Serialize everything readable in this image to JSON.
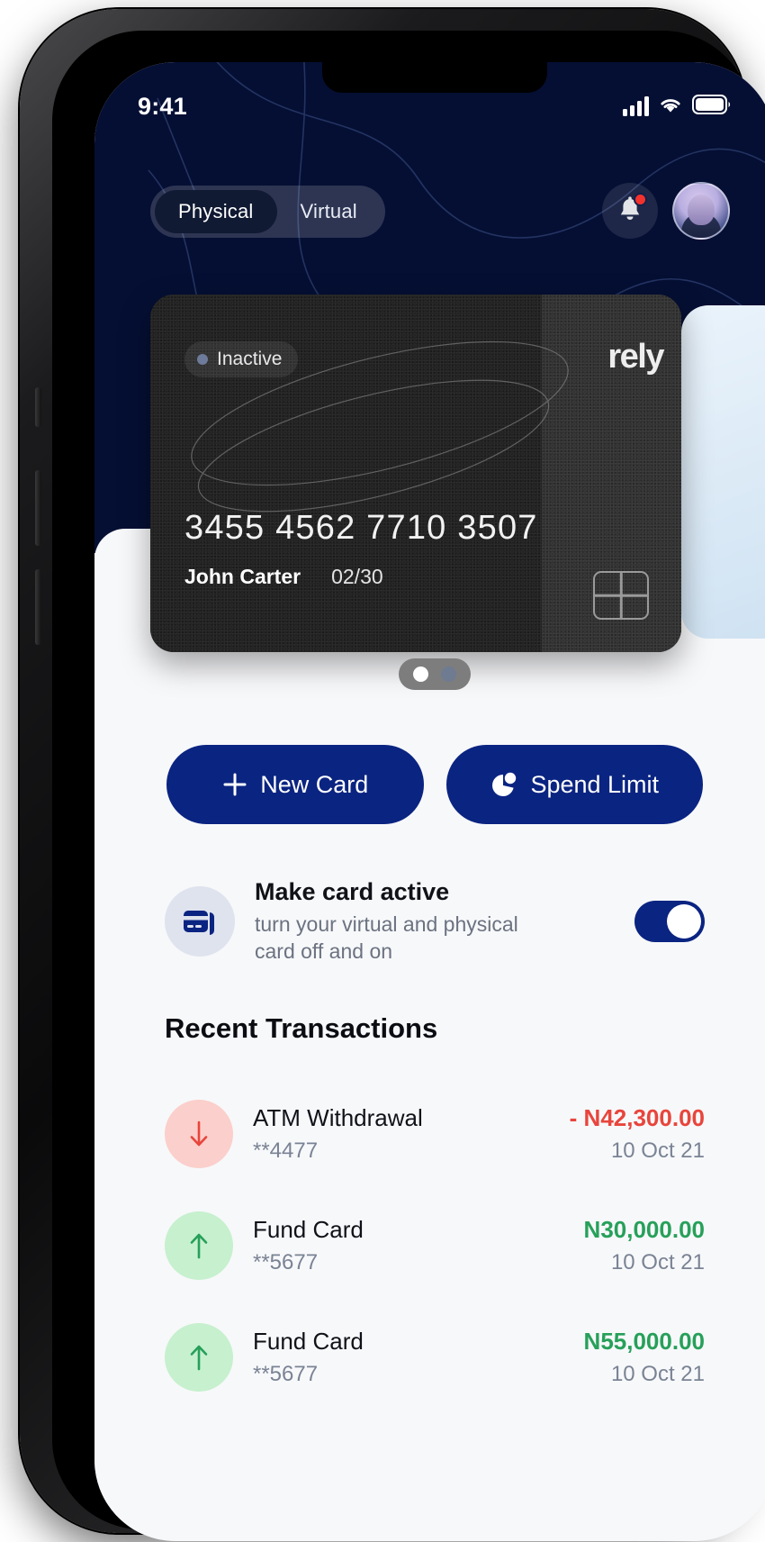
{
  "status_bar": {
    "time": "9:41",
    "cellular_icon": "signal-bars-icon",
    "wifi_icon": "wifi-icon",
    "battery_icon": "battery-icon"
  },
  "header": {
    "segments": [
      {
        "label": "Physical",
        "active": true
      },
      {
        "label": "Virtual",
        "active": false
      }
    ],
    "bell_icon": "bell-icon",
    "notification_dot": true,
    "avatar_icon": "user-avatar"
  },
  "card": {
    "status_label": "Inactive",
    "number": "3455 4562 7710 3507",
    "holder": "John Carter",
    "expiry": "02/30",
    "brand": "rely",
    "chip_icon": "card-chip-icon"
  },
  "carousel": {
    "dots": [
      {
        "active": true
      },
      {
        "active": false
      }
    ]
  },
  "actions": {
    "new_card": {
      "label": "New Card",
      "icon": "plus-icon"
    },
    "spend_limit": {
      "label": "Spend Limit",
      "icon": "pie-chart-icon"
    }
  },
  "card_active": {
    "icon": "credit-card-icon",
    "title": "Make card active",
    "subtitle": "turn your virtual and physical card off and on",
    "toggle_on": true
  },
  "transactions": {
    "title": "Recent Transactions",
    "items": [
      {
        "name": "ATM Withdrawal",
        "mask": "**4477",
        "amount": "- N42,300.00",
        "date": "10 Oct 21",
        "direction": "debit",
        "icon": "arrow-down-icon"
      },
      {
        "name": "Fund Card",
        "mask": "**5677",
        "amount": "N30,000.00",
        "date": "10 Oct 21",
        "direction": "credit",
        "icon": "arrow-up-icon"
      },
      {
        "name": "Fund Card",
        "mask": "**5677",
        "amount": "N55,000.00",
        "date": "10 Oct 21",
        "direction": "credit",
        "icon": "arrow-up-icon"
      }
    ]
  },
  "colors": {
    "hero_background": "#050f33",
    "primary": "#0a2481",
    "debit": "#e8453c",
    "credit": "#27a05a",
    "card_dark": "#232323",
    "sheet": "#f7f8fa"
  }
}
